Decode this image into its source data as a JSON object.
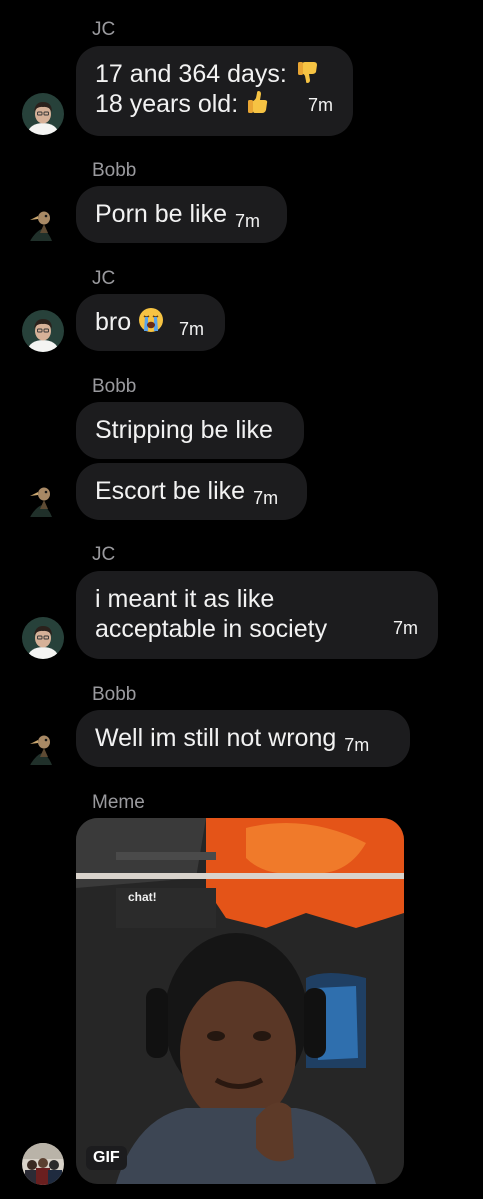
{
  "messages": [
    {
      "sender": "JC",
      "lines": [
        "17 and 364 days:",
        "18 years old:"
      ],
      "emojis": [
        "thumbs-down-icon",
        "thumbs-up-icon"
      ],
      "time": "7m"
    },
    {
      "sender": "Bobb",
      "text": "Porn be like",
      "time": "7m"
    },
    {
      "sender": "JC",
      "text": "bro",
      "emoji": "loudly-crying-face-icon",
      "time": "7m"
    },
    {
      "sender": "Bobb",
      "text": "Stripping be like"
    },
    {
      "text": "Escort be like",
      "time": "7m"
    },
    {
      "sender": "JC",
      "lines": [
        "i meant it as like",
        "acceptable in society"
      ],
      "time": "7m"
    },
    {
      "sender": "Bobb",
      "text": "Well im still not wrong",
      "time": "7m"
    },
    {
      "sender": "Meme",
      "gif_badge": "GIF",
      "gif_caption": "chat!"
    }
  ],
  "colors": {
    "background": "#000000",
    "bubble": "#1c1c1e",
    "sender_label": "#9a9a9e",
    "text": "#f2f2f2"
  }
}
